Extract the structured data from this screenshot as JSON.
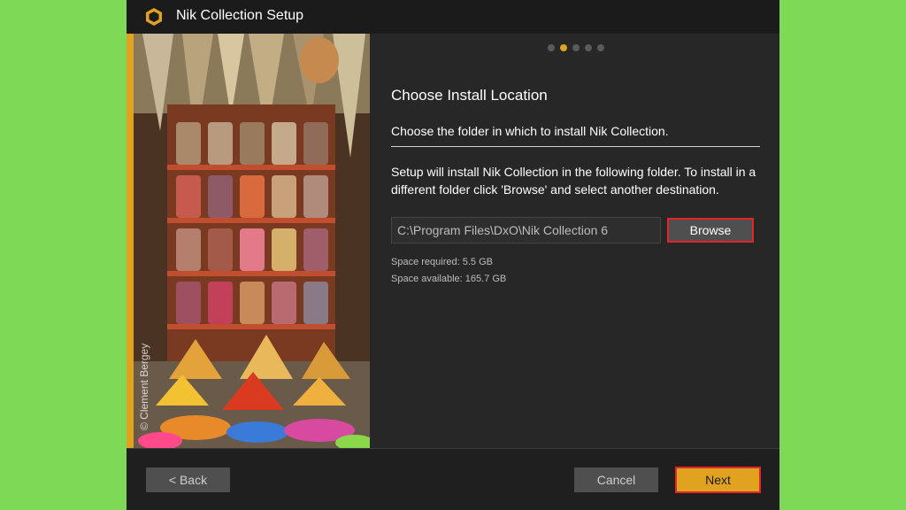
{
  "window": {
    "title": "Nik Collection Setup"
  },
  "image_panel": {
    "credit": "© Clement Bergey"
  },
  "progress": {
    "steps": 5,
    "active_step": 2
  },
  "content": {
    "heading": "Choose Install Location",
    "subheading": "Choose the folder in which to install Nik Collection.",
    "description": "Setup will install Nik Collection in the following folder. To install in a different folder click 'Browse' and select another destination.",
    "install_path": "C:\\Program Files\\DxO\\Nik Collection 6",
    "browse_label": "Browse",
    "space_required": "Space required: 5.5 GB",
    "space_available": "Space available: 165.7 GB"
  },
  "footer": {
    "back_label": "< Back",
    "cancel_label": "Cancel",
    "next_label": "Next"
  },
  "colors": {
    "accent": "#e1a21f",
    "highlight_border": "#e3242b",
    "background": "#7ed957"
  }
}
